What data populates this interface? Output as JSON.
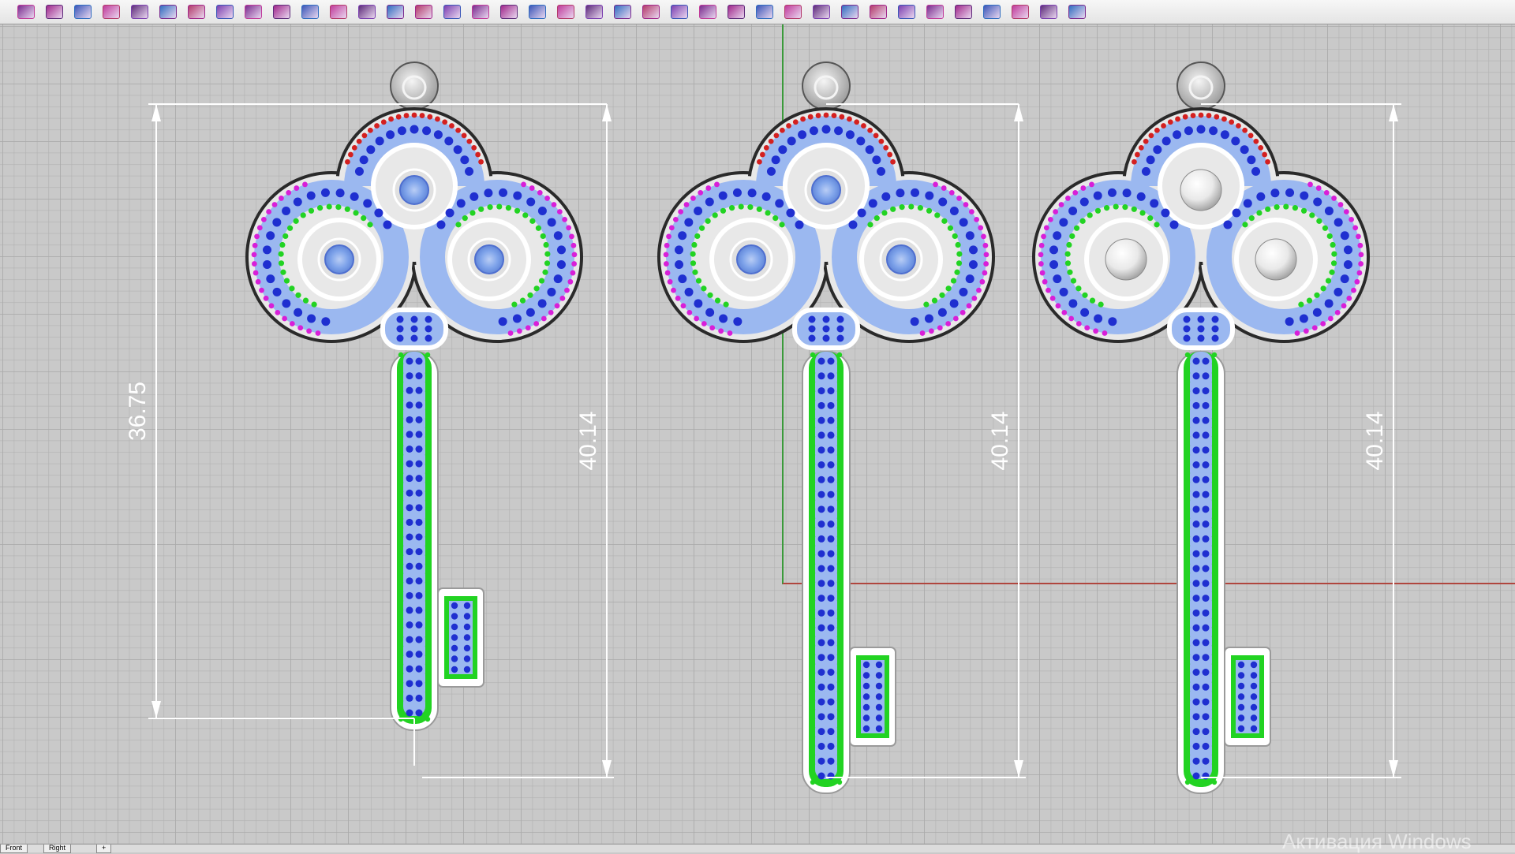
{
  "toolbar": {
    "icons": [
      "undo-icon",
      "lasso-icon",
      "select-icon",
      "surface-icon",
      "grid-icon",
      "curve-icon",
      "box-icon",
      "extrude-icon",
      "solid-icon",
      "cube-icon",
      "arrow-icon",
      "mesh-icon",
      "panel-icon",
      "layout-icon",
      "array-icon",
      "fillet-icon",
      "loft-icon",
      "sweep-icon",
      "revolve-icon",
      "blend-icon",
      "chain-icon",
      "gem-icon",
      "pave-icon",
      "rail-icon",
      "bend-icon",
      "point-icon",
      "dimension-icon",
      "render-icon",
      "light-icon",
      "star-icon",
      "sphere-icon",
      "flow-icon",
      "stack-icon",
      "text-icon",
      "layers-icon",
      "cage-icon",
      "material-icon",
      "settings-icon"
    ]
  },
  "viewport": {
    "grid_color": "#b1b1b1",
    "background": "#c9c9c9",
    "x_axis_color": "#b0463e",
    "y_axis_color": "#3a9a3a"
  },
  "dimensions": {
    "left_height": "36.75",
    "key1_height": "40.14",
    "key2_height": "40.14",
    "key3_height": "40.14"
  },
  "keys": [
    {
      "name": "key-left",
      "center_stone": "blue"
    },
    {
      "name": "key-middle",
      "center_stone": "blue"
    },
    {
      "name": "key-right",
      "center_stone": "pearl"
    }
  ],
  "colors": {
    "blue_gem": "#1f2fd0",
    "light_blue_fill": "#9bb8f0",
    "green_gem": "#22d322",
    "magenta_gem": "#d81fd8",
    "red_gem": "#d42020",
    "metal": "#e8e8e8",
    "outline": "#2a2a2a"
  },
  "view_tabs": [
    "Front",
    "Right",
    "+"
  ],
  "watermark": "Активация Windows"
}
